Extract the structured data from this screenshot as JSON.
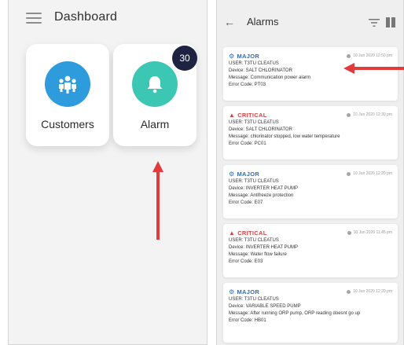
{
  "dashboard": {
    "title": "Dashboard",
    "cards": [
      {
        "label": "Customers",
        "icon": "users-icon"
      },
      {
        "label": "Alarm",
        "icon": "bell-icon",
        "badge": "30"
      }
    ]
  },
  "alarms": {
    "title": "Alarms",
    "items": [
      {
        "severity": "MAJOR",
        "timestamp": "10 Jun 2020 12:50 pm",
        "user": "USER: T3TU CLEATUS",
        "device": "Device: SALT CHLORINATOR",
        "message": "Message: Communication power alarm",
        "error": "Error Code: PT03"
      },
      {
        "severity": "CRITICAL",
        "timestamp": "10 Jun 2020 12:30 pm",
        "user": "USER: T3TU CLEATUS",
        "device": "Device: SALT CHLORINATOR",
        "message": "Message: chlorinator stopped, low water temperature",
        "error": "Error Code: PC01"
      },
      {
        "severity": "MAJOR",
        "timestamp": "10 Jun 2020 12:20 pm",
        "user": "USER: T3TU CLEATUS",
        "device": "Device: INVERTER HEAT PUMP",
        "message": "Message: Antifreeze protection",
        "error": "Error Code: E07"
      },
      {
        "severity": "CRITICAL",
        "timestamp": "10 Jun 2020 11:45 pm",
        "user": "USER: T3TU CLEATUS",
        "device": "Device: INVERTER HEAT PUMP",
        "message": "Message: Water flow failure",
        "error": "Error Code: E03"
      },
      {
        "severity": "MAJOR",
        "timestamp": "10 Jun 2020 12:20 pm",
        "user": "USER: T3TU CLEATUS",
        "device": "Device: VARIABLE SPEED PUMP",
        "message": "Message: After running ORP pump, ORP reading doesnt go up",
        "error": "Error Code: HB01"
      }
    ]
  },
  "colors": {
    "major": "#2b6fb5",
    "critical": "#d64545",
    "annotation_arrow": "#e23b3b"
  }
}
